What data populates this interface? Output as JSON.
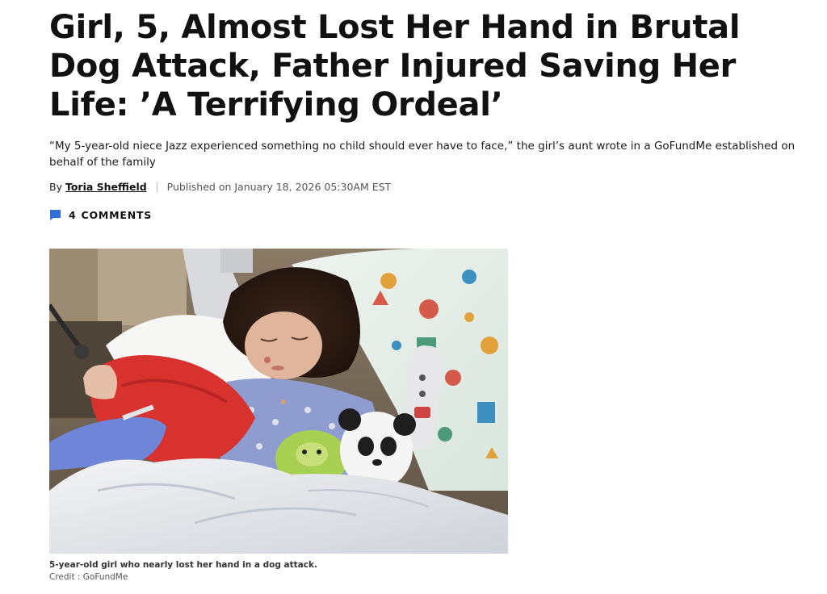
{
  "article": {
    "headline": "Girl, 5, Almost Lost Her Hand in Brutal Dog Attack, Father Injured Saving Her Life: ’A Terrifying Ordeal’",
    "dek": "“My 5-year-old niece Jazz experienced something no child should ever have to face,” the girl’s aunt wrote in a GoFundMe established on behalf of the family",
    "byline": {
      "prefix": "By",
      "author": "Toria Sheffield",
      "published": "Published on January 18, 2026 05:30AM EST"
    },
    "comments": {
      "count": "4",
      "label": "COMMENTS",
      "icon": "comment-bubble-icon",
      "icon_color": "#2f6fd6"
    },
    "image": {
      "caption": "5-year-old girl who nearly lost her hand in a dog attack.",
      "credit": "Credit : GoFundMe"
    }
  },
  "colors": {
    "text": "#111111",
    "accent": "#2f6fd6"
  }
}
